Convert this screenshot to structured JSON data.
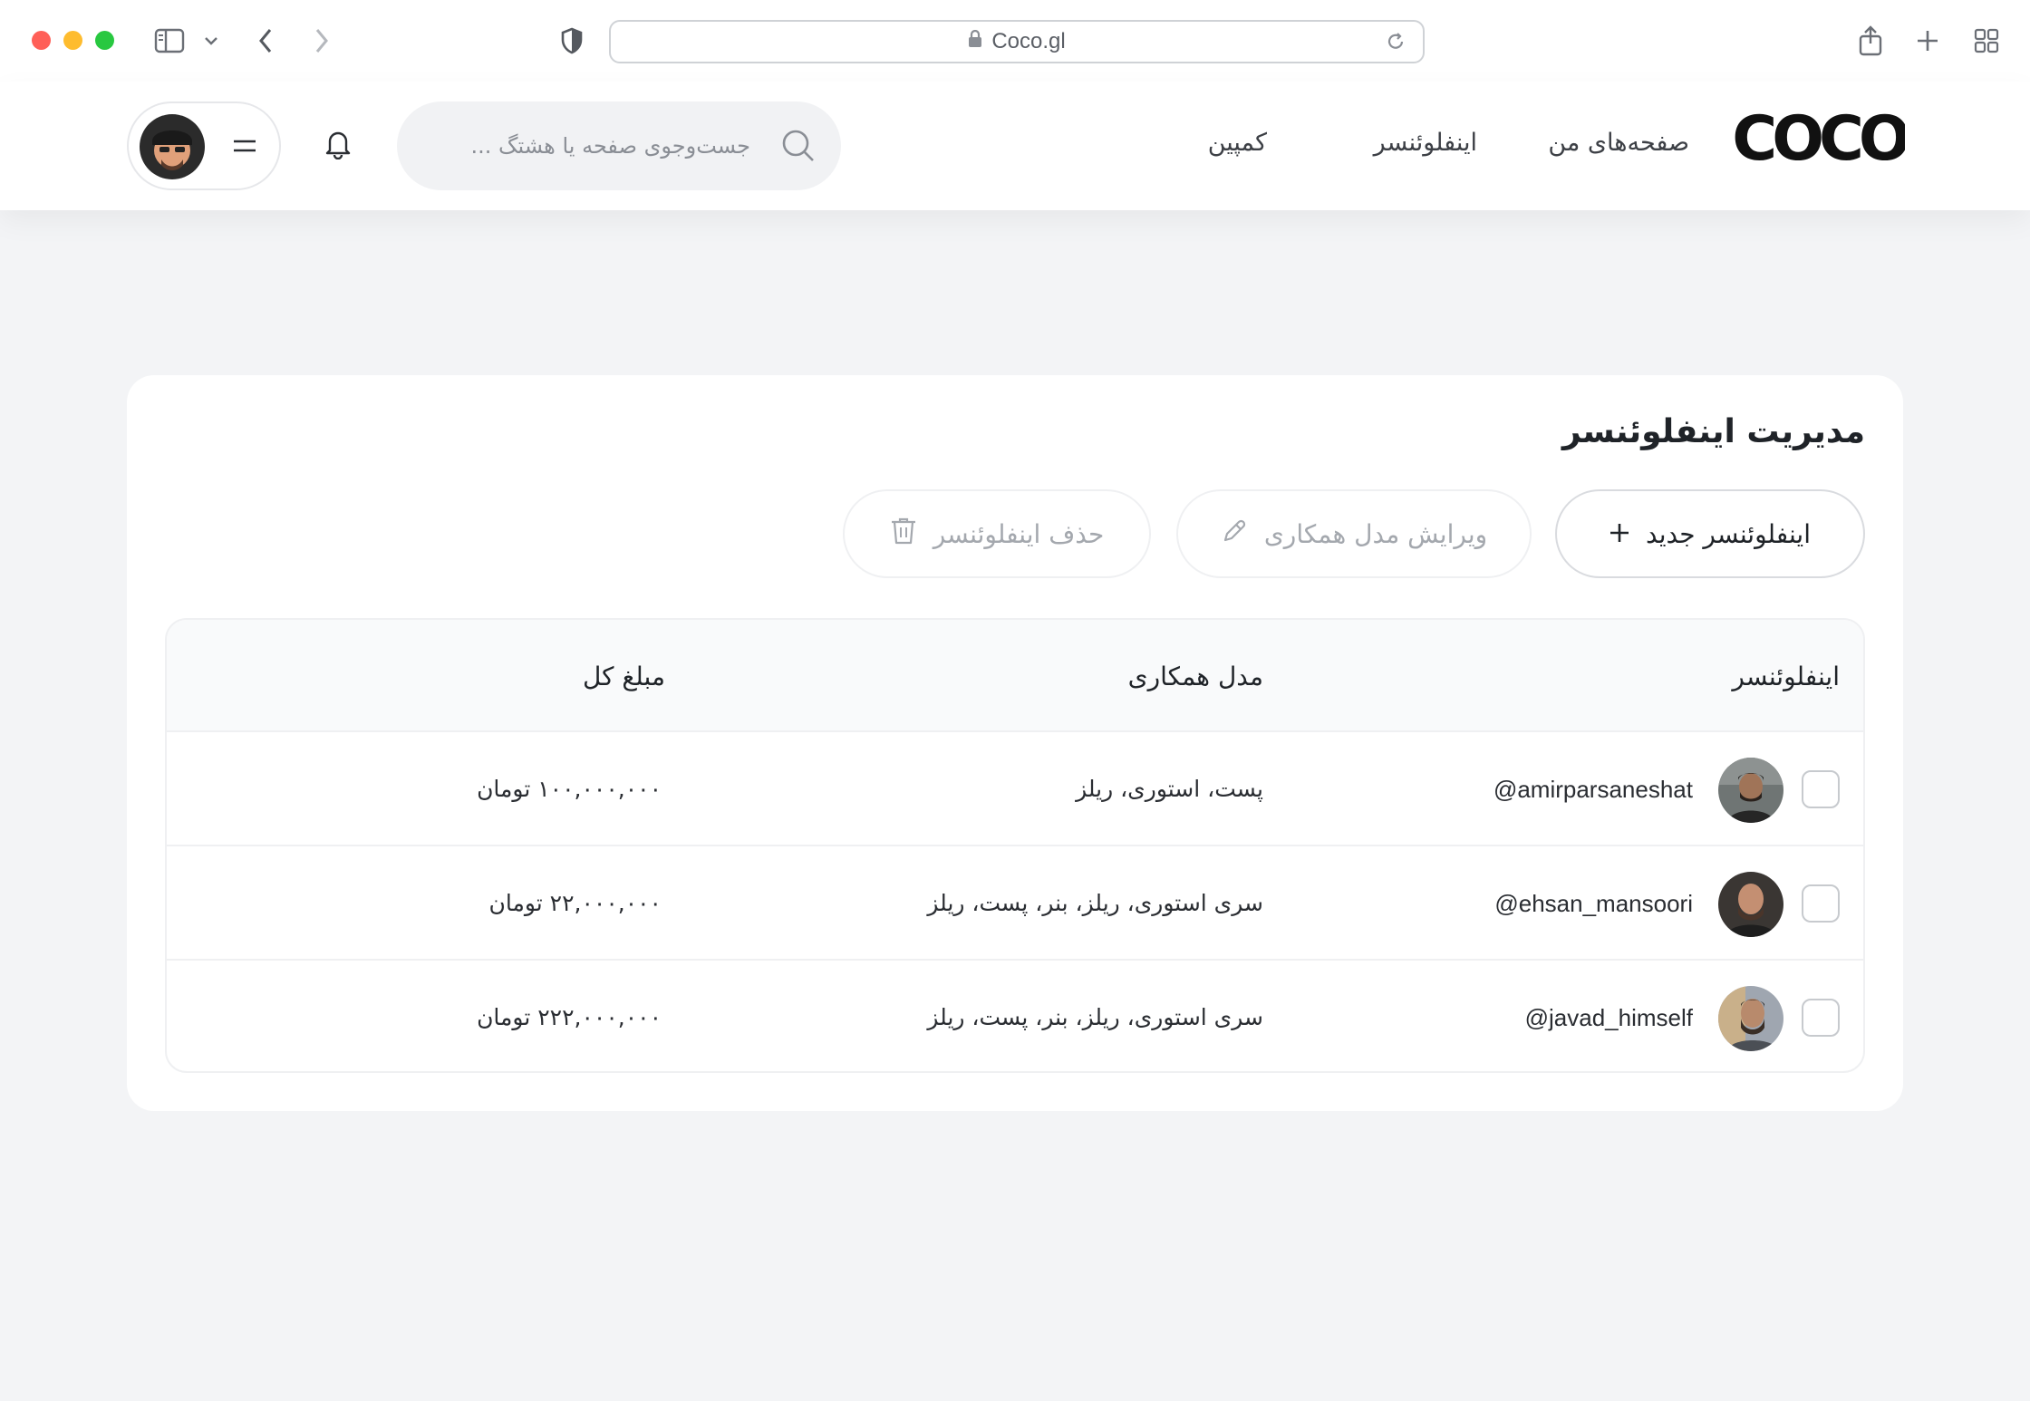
{
  "browser": {
    "url": "Coco.gl"
  },
  "header": {
    "logo_text": "COCO",
    "nav": [
      {
        "label": "صفحه‌های من"
      },
      {
        "label": "اینفلوئنسر"
      },
      {
        "label": "کمپین"
      }
    ],
    "search": {
      "placeholder": "جست‌وجوی صفحه یا هشتگ ..."
    }
  },
  "card": {
    "title": "مدیریت اینفلوئنسر",
    "buttons": {
      "new": "اینفلوئنسر جدید",
      "edit": "ویرایش مدل همکاری",
      "delete": "حذف اینفلوئنسر"
    },
    "table": {
      "columns": {
        "influencer": "اینفلوئنسر",
        "model": "مدل همکاری",
        "amount": "مبلغ کل"
      },
      "rows": [
        {
          "handle": "@amirparsaneshat",
          "model": "پست، استوری، ریلز",
          "amount": "۱۰۰,۰۰۰,۰۰۰ تومان"
        },
        {
          "handle": "@ehsan_mansoori",
          "model": "سری استوری، ریلز، بنر، پست، ریلز",
          "amount": "۲۲,۰۰۰,۰۰۰ تومان"
        },
        {
          "handle": "@javad_himself",
          "model": "سری استوری، ریلز، بنر، پست، ریلز",
          "amount": "۲۲۲,۰۰۰,۰۰۰ تومان"
        }
      ]
    }
  },
  "colors": {
    "background": "#f3f4f6",
    "card": "#ffffff",
    "text": "#1f2328",
    "muted": "#a4a8ae"
  }
}
